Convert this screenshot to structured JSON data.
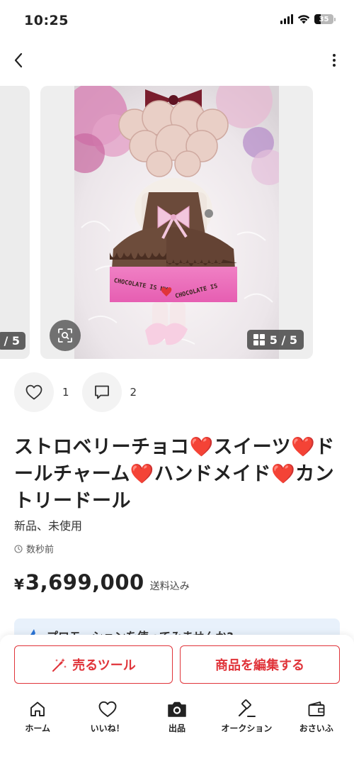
{
  "status": {
    "time": "10:25",
    "battery": "35",
    "battery_fraction": 0.35
  },
  "nav": {
    "back_icon": "chevron-left-icon",
    "more_icon": "more-vertical-icon"
  },
  "gallery": {
    "prev_counter": "/ 5",
    "counter": "5 / 5",
    "photo_texts": {
      "left_band": "CHOCOLATE IS MY",
      "right_band": "CHOCOLATE IS"
    }
  },
  "reactions": {
    "like_count": "1",
    "comment_count": "2"
  },
  "item": {
    "title": "ストロベリーチョコ❤️スイーツ❤️ドールチャーム❤️ハンドメイド❤️カントリードール",
    "condition": "新品、未使用",
    "posted": "数秒前",
    "price_symbol": "¥",
    "price": "3,699,000",
    "shipping": "送料込み"
  },
  "promo": {
    "text": "プロモーションを使ってみませんか?"
  },
  "actions": {
    "sell_tool": "売るツール",
    "edit_item": "商品を編集する"
  },
  "tabs": [
    {
      "label": "ホーム",
      "icon": "home-icon"
    },
    {
      "label": "いいね！",
      "icon": "heart-icon"
    },
    {
      "label": "出品",
      "icon": "camera-icon"
    },
    {
      "label": "オークション",
      "icon": "gavel-icon"
    },
    {
      "label": "おさいふ",
      "icon": "wallet-icon"
    }
  ],
  "colors": {
    "accent": "#e0343a",
    "promo_bg": "#e8f1fb"
  }
}
